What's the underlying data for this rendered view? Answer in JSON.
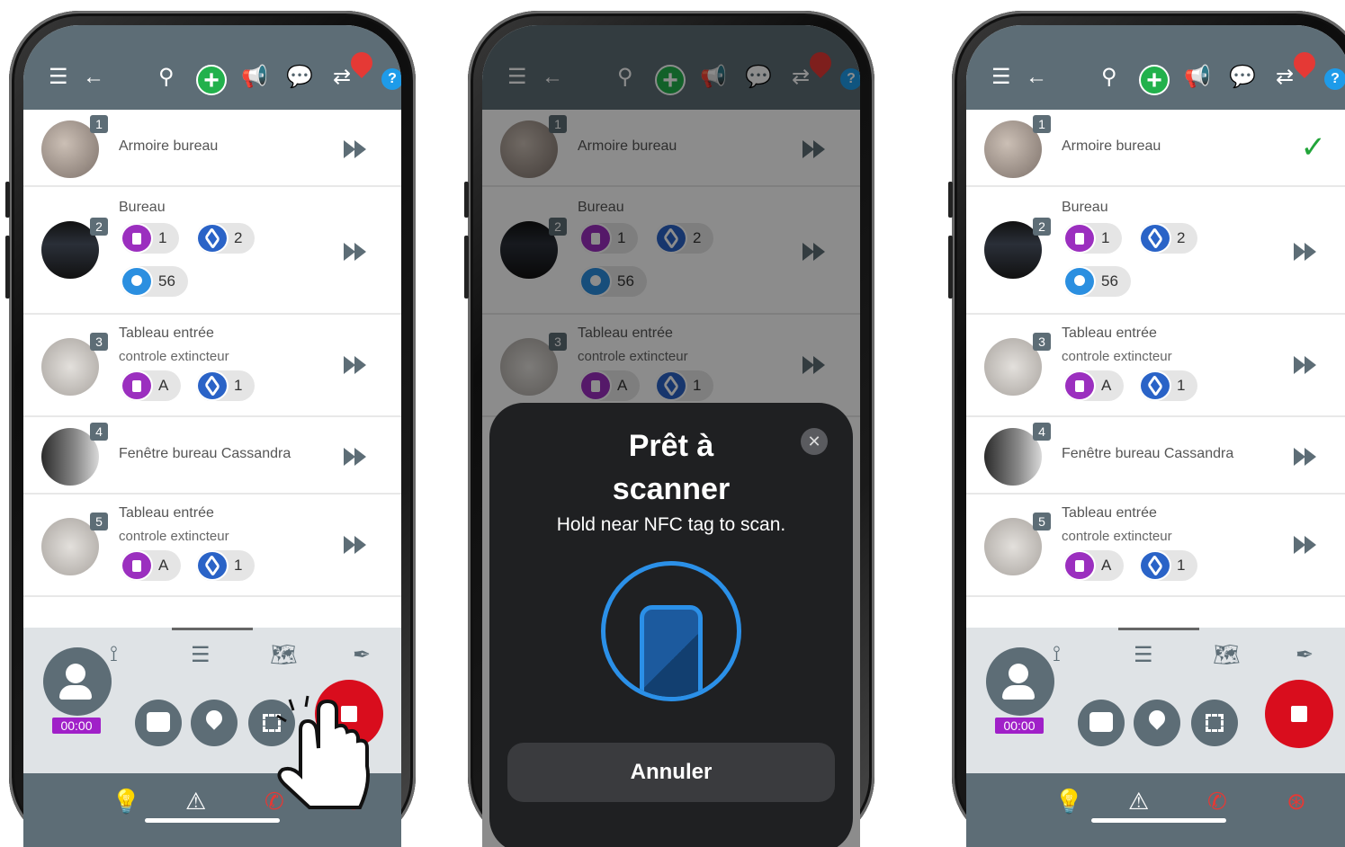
{
  "phones": [
    {
      "items": [
        {
          "num": "1",
          "title": "Armoire bureau"
        },
        {
          "num": "2",
          "title": "Bureau",
          "chips": [
            "1",
            "2",
            "56"
          ]
        },
        {
          "num": "3",
          "title": "Tableau entrée",
          "sub": "controle extincteur",
          "chips": [
            "A",
            "1"
          ]
        },
        {
          "num": "4",
          "title": "Fenêtre bureau Cassandra"
        },
        {
          "num": "5",
          "title": "Tableau entrée",
          "sub": "controle extincteur",
          "chips": [
            "A",
            "1"
          ]
        }
      ],
      "timer": "00:00"
    },
    {
      "items": [
        {
          "num": "1",
          "title": "Armoire bureau"
        },
        {
          "num": "2",
          "title": "Bureau",
          "chips": [
            "1",
            "2",
            "56"
          ]
        },
        {
          "num": "3",
          "title": "Tableau entrée",
          "sub": "controle extincteur",
          "chips": [
            "A",
            "1"
          ]
        }
      ],
      "nfc_sheet": {
        "title_line1": "Prêt à",
        "title_line2": "scanner",
        "subtitle": "Hold near NFC tag to scan.",
        "cancel_label": "Annuler"
      }
    },
    {
      "items": [
        {
          "num": "1",
          "title": "Armoire bureau"
        },
        {
          "num": "2",
          "title": "Bureau",
          "chips": [
            "1",
            "2",
            "56"
          ]
        },
        {
          "num": "3",
          "title": "Tableau entrée",
          "sub": "controle extincteur",
          "chips": [
            "A",
            "1"
          ]
        },
        {
          "num": "4",
          "title": "Fenêtre bureau Cassandra"
        },
        {
          "num": "5",
          "title": "Tableau entrée",
          "sub": "controle extincteur",
          "chips": [
            "A",
            "1"
          ]
        }
      ],
      "timer": "00:00"
    }
  ],
  "colors": {
    "header": "#5d6d76",
    "add": "#22b14c",
    "stop": "#d90d1d",
    "timer": "#a020c8",
    "check": "#22a53a",
    "nfc_ring": "#2b90e8"
  },
  "icons": [
    "menu-icon",
    "back-icon",
    "search-icon",
    "add-icon",
    "megaphone-icon",
    "chat-icon",
    "sync-icon",
    "help-icon",
    "play-next-icon",
    "check-icon",
    "route-icon",
    "numbered-list-icon",
    "map-icon",
    "pen-icon",
    "message-icon",
    "location-icon",
    "qr-icon",
    "stop-icon",
    "lightbulb-icon",
    "warning-icon",
    "phone-icon",
    "lifebuoy-icon"
  ]
}
